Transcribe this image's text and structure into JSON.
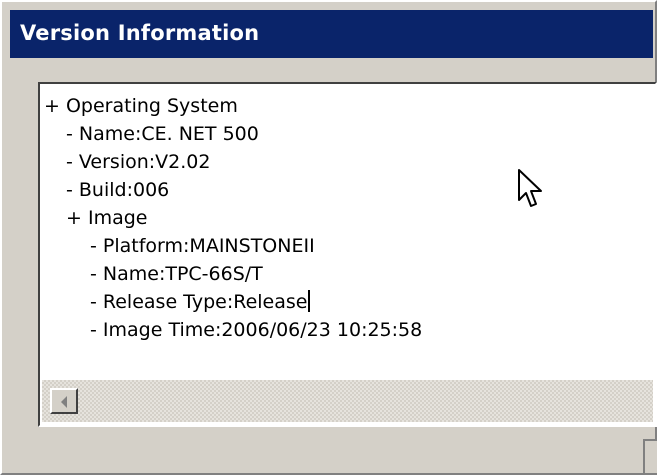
{
  "window": {
    "title": "Version Information"
  },
  "tree": {
    "lines": [
      "+ Operating System",
      "- Name:CE. NET 500",
      "- Version:V2.02",
      "- Build:006",
      "+ Image",
      "- Platform:MAINSTONEII",
      "- Name:TPC-66S/T",
      "- Release Type:Release",
      "- Image Time:2006/06/23 10:25:58"
    ]
  },
  "icons": {
    "scroll_left": "scroll-left-arrow-icon",
    "cursor": "mouse-pointer-icon"
  },
  "colors": {
    "titlebar": "#0a246a",
    "window_bg": "#d4d0c8",
    "panel_bg": "#ffffff"
  }
}
